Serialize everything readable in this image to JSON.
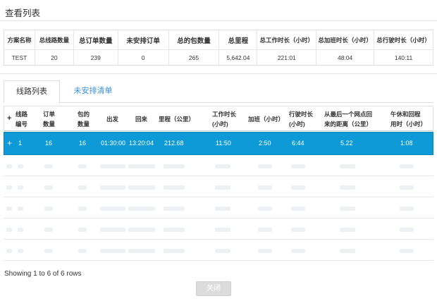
{
  "window": {
    "title": "查看列表"
  },
  "summary": {
    "headers": [
      "方案名称",
      "总线路数量",
      "总订单数量",
      "未安排订单",
      "总的包数量",
      "总里程",
      "总工作时长（小时）",
      "总加班时长（小时）",
      "总行驶时长（小时）"
    ],
    "values": [
      "TEST",
      "20",
      "239",
      "0",
      "265",
      "5,642.04",
      "221:01",
      "48:04",
      "140:11"
    ]
  },
  "tabs": {
    "active": "线路列表",
    "inactive": "未安排清单"
  },
  "routes": {
    "headers": {
      "expand": "+",
      "route_no_1": "线路",
      "route_no_2": "编号",
      "orders_1": "订单",
      "orders_2": "数量",
      "packs_1": "包的",
      "packs_2": "数量",
      "depart": "出发",
      "return": "回来",
      "mileage": "里程（公里）",
      "work_1": "工作时长",
      "work_2": "(小时)",
      "overtime": "加班（小时）",
      "drive_1": "行驶时长",
      "drive_2": "(小时)",
      "dist_1": "从最后一个网点回",
      "dist_2": "来的距离（公里）",
      "rest_1": "午休和回程",
      "rest_2": "用时（小时）"
    },
    "selected_row": {
      "expand": "+",
      "route_no": "1",
      "orders": "16",
      "packs": "16",
      "depart": "01:30:00",
      "return": "13:20:04",
      "mileage": "212.68",
      "work": "11:50",
      "overtime": "2:50",
      "drive": "6:44",
      "dist": "5.22",
      "rest": "1:08"
    }
  },
  "footer": {
    "info": "Showing 1 to 6 of 6 rows",
    "close_label": "关闭"
  }
}
